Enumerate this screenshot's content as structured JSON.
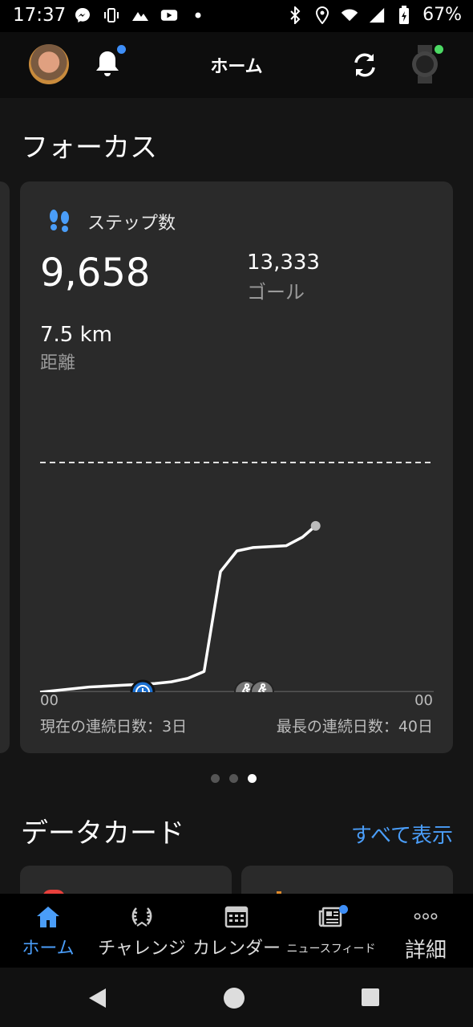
{
  "status_bar": {
    "time": "17:37",
    "battery": "67%"
  },
  "app_bar": {
    "title": "ホーム"
  },
  "focus": {
    "section_title": "フォーカス",
    "card": {
      "label": "ステップ数",
      "steps": "9,658",
      "goal_value": "13,333",
      "goal_label": "ゴール",
      "distance_value": "7.5 km",
      "distance_label": "距離",
      "axis_start": "00",
      "axis_end": "00",
      "current_streak": "現在の連続日数：3日",
      "longest_streak": "最長の連続日数：40日"
    },
    "pager": {
      "count": 3,
      "active_index": 2
    }
  },
  "chart_data": {
    "type": "line",
    "x": [
      0,
      1,
      2,
      3,
      4,
      5,
      6,
      7,
      8,
      9,
      10,
      11,
      12,
      13,
      14,
      15,
      16,
      16.8
    ],
    "series": [
      {
        "values": [
          0,
          100,
          200,
          300,
          350,
          400,
          450,
          500,
          600,
          800,
          1200,
          7000,
          8200,
          8400,
          8450,
          8500,
          9000,
          9658
        ]
      }
    ],
    "goal_value": 13333,
    "ylim": [
      0,
      13333
    ],
    "grid": false
  },
  "data_cards": {
    "section_title": "データカード",
    "see_all": "すべて表示"
  },
  "bottom_nav": {
    "items": [
      {
        "label": "ホーム",
        "icon": "home-icon",
        "active": true
      },
      {
        "label": "チャレンジ",
        "icon": "laurel-icon",
        "active": false
      },
      {
        "label": "カレンダー",
        "icon": "calendar-icon",
        "active": false
      },
      {
        "label": "ニュースフィード",
        "icon": "newsfeed-icon",
        "active": false
      },
      {
        "label": "詳細",
        "icon": "more-icon",
        "active": false
      }
    ]
  },
  "colors": {
    "accent": "#4a9df8",
    "card_bg": "#2a2a2a",
    "notification_dot": "#3e8ef7",
    "connected_dot": "#4cd964"
  }
}
